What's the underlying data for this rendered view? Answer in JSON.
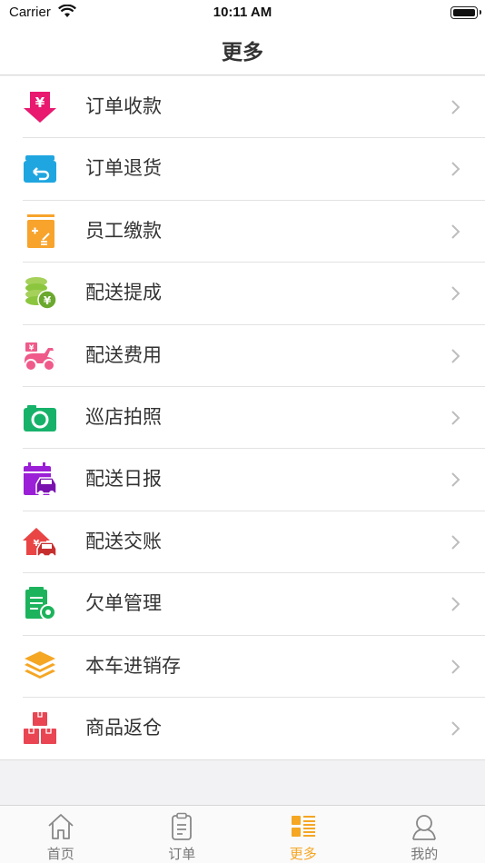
{
  "status_bar": {
    "carrier": "Carrier",
    "time": "10:11 AM"
  },
  "nav": {
    "title": "更多"
  },
  "menu": {
    "items": [
      {
        "label": "订单收款",
        "icon": "yen-download-icon",
        "color": "#e8196f"
      },
      {
        "label": "订单退货",
        "icon": "return-box-icon",
        "color": "#1fa6e0"
      },
      {
        "label": "员工缴款",
        "icon": "calculator-icon",
        "color": "#f7a32c"
      },
      {
        "label": "配送提成",
        "icon": "coins-yen-icon",
        "color": "#8cc63f"
      },
      {
        "label": "配送费用",
        "icon": "scooter-icon",
        "color": "#ef5a8a"
      },
      {
        "label": "巡店拍照",
        "icon": "camera-icon",
        "color": "#17b26a"
      },
      {
        "label": "配送日报",
        "icon": "calendar-truck-icon",
        "color": "#9b1fd6"
      },
      {
        "label": "配送交账",
        "icon": "house-truck-icon",
        "color": "#e94545"
      },
      {
        "label": "欠单管理",
        "icon": "document-gear-icon",
        "color": "#1cb35c"
      },
      {
        "label": "本车进销存",
        "icon": "layers-icon",
        "color": "#f5a623"
      },
      {
        "label": "商品返仓",
        "icon": "boxes-icon",
        "color": "#e94552"
      }
    ]
  },
  "tabbar": {
    "tabs": [
      {
        "label": "首页",
        "icon": "home-icon"
      },
      {
        "label": "订单",
        "icon": "clipboard-icon"
      },
      {
        "label": "更多",
        "icon": "more-grid-icon",
        "active": true
      },
      {
        "label": "我的",
        "icon": "user-icon"
      }
    ],
    "active_color": "#f5a623"
  }
}
